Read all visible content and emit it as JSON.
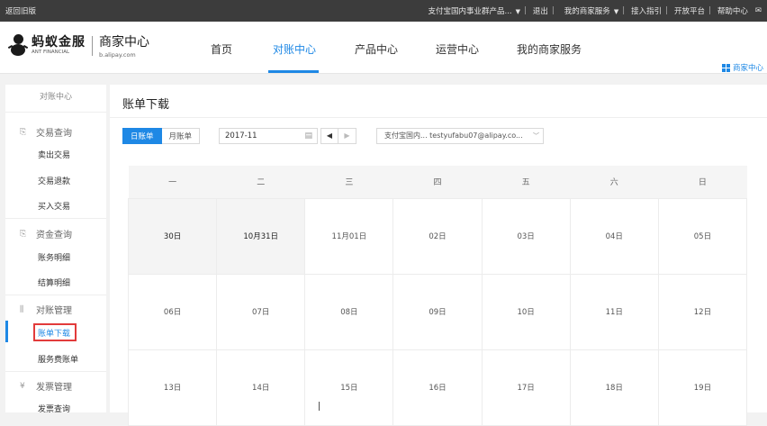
{
  "topbar": {
    "back": "返回旧版",
    "account": "支付宝国内事业群产品...",
    "logout": "退出",
    "services": "我的商家服务",
    "guide": "接入指引",
    "platform": "开放平台",
    "help": "帮助中心"
  },
  "header": {
    "brand_cn": "蚂蚁金服",
    "brand_en": "ANT FINANCIAL",
    "product_cn": "商家中心",
    "product_en": "b.alipay.com",
    "nav": [
      "首页",
      "对账中心",
      "产品中心",
      "运营中心",
      "我的商家服务"
    ],
    "merchant_link": "商家中心"
  },
  "sidebar": {
    "title": "对账中心",
    "groups": [
      {
        "label": "交易查询",
        "items": [
          "卖出交易",
          "交易退款",
          "买入交易"
        ]
      },
      {
        "label": "资金查询",
        "items": [
          "账务明细",
          "结算明细"
        ]
      },
      {
        "label": "对账管理",
        "items": [
          "账单下载",
          "服务费账单"
        ]
      },
      {
        "label": "发票管理",
        "items": [
          "发票查询"
        ]
      }
    ]
  },
  "main": {
    "title": "账单下载",
    "tabs": [
      "日账单",
      "月账单"
    ],
    "month": "2017-11",
    "account": "支付宝国内...    testyufabu07@alipay.co...",
    "weekdays": [
      "一",
      "二",
      "三",
      "四",
      "五",
      "六",
      "日"
    ],
    "weeks": [
      [
        "30日",
        "10月31日",
        "11月01日",
        "02日",
        "03日",
        "04日",
        "05日"
      ],
      [
        "06日",
        "07日",
        "08日",
        "09日",
        "10日",
        "11日",
        "12日"
      ],
      [
        "13日",
        "14日",
        "15日",
        "16日",
        "17日",
        "18日",
        "19日"
      ]
    ]
  }
}
